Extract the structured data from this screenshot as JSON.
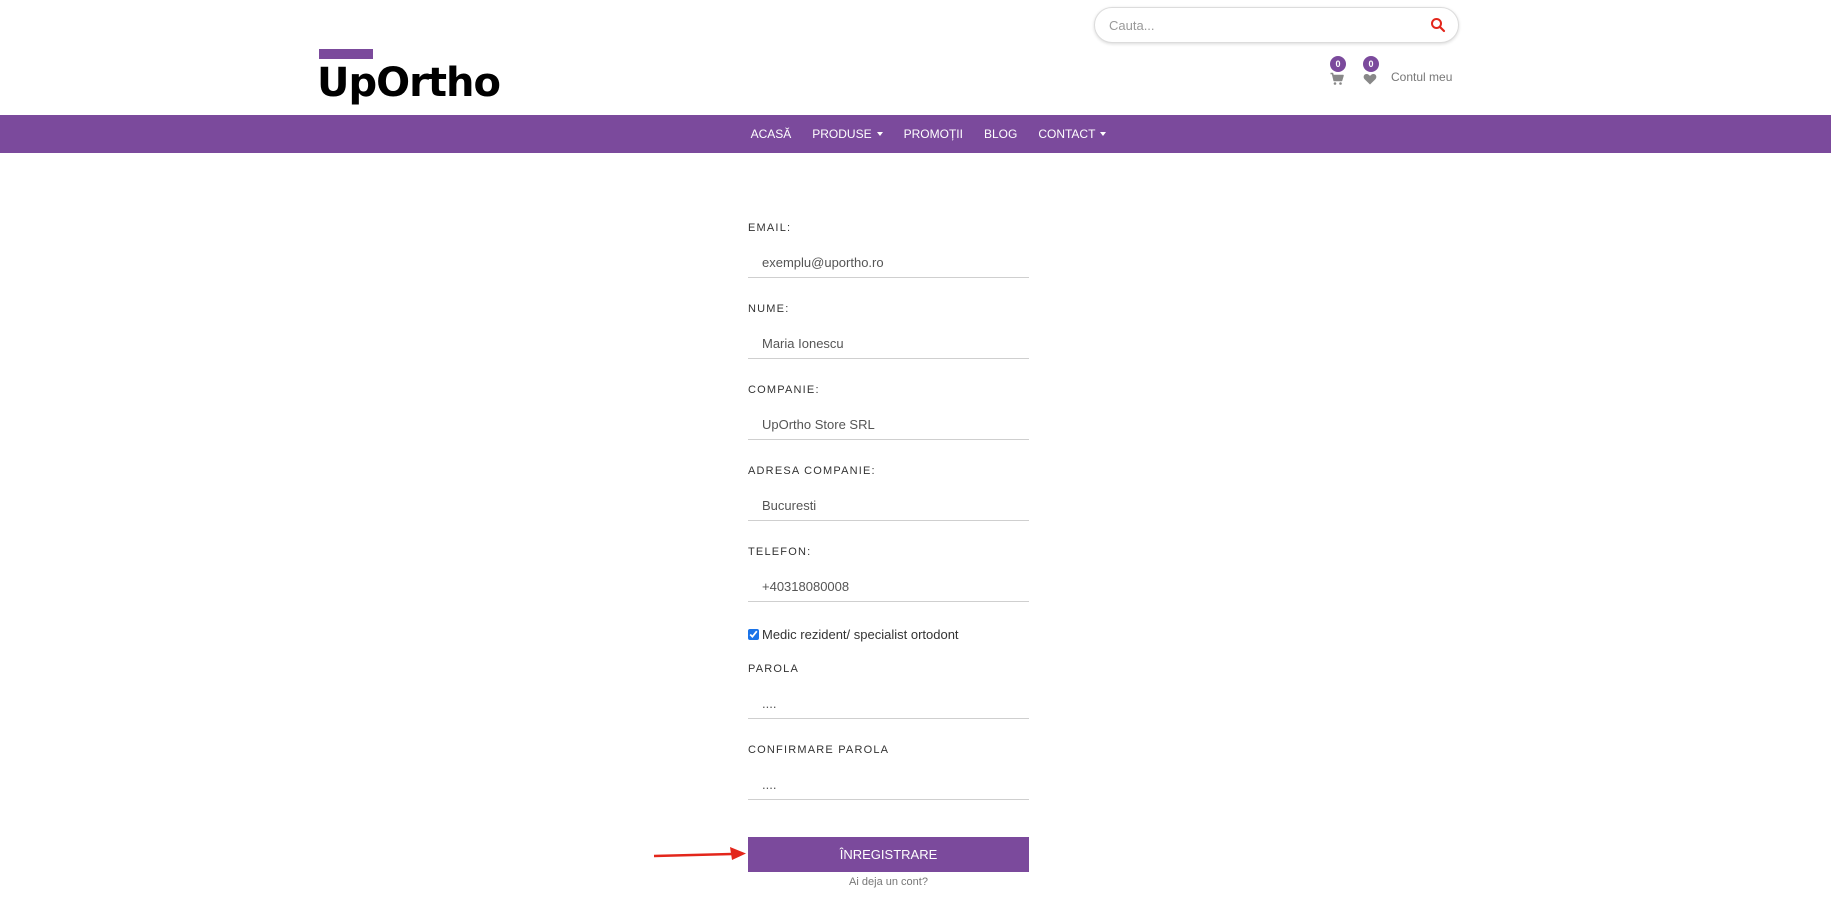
{
  "colors": {
    "brand": "#7b4a9c",
    "accent_red": "#e3261b",
    "icon_gray": "#888888"
  },
  "header": {
    "search": {
      "placeholder": "Cauta...",
      "icon": "search-icon"
    },
    "logo": {
      "text": "UpOrtho"
    },
    "cart": {
      "count": "0",
      "icon": "cart-icon"
    },
    "wishlist": {
      "count": "0",
      "icon": "heart-icon"
    },
    "account_label": "Contul meu"
  },
  "nav": {
    "items": [
      {
        "label": "ACASĂ",
        "dropdown": false
      },
      {
        "label": "PRODUSE",
        "dropdown": true
      },
      {
        "label": "PROMOȚII",
        "dropdown": false
      },
      {
        "label": "BLOG",
        "dropdown": false
      },
      {
        "label": "CONTACT",
        "dropdown": true
      }
    ]
  },
  "form": {
    "fields": [
      {
        "label": "EMAIL:",
        "value": "exemplu@uportho.ro"
      },
      {
        "label": "NUME:",
        "value": "Maria Ionescu"
      },
      {
        "label": "COMPANIE:",
        "value": "UpOrtho Store SRL"
      },
      {
        "label": "ADRESA COMPANIE:",
        "value": "Bucuresti"
      },
      {
        "label": "TELEFON:",
        "value": "+40318080008"
      }
    ],
    "checkbox": {
      "label": "Medic rezident/ specialist ortodont",
      "checked": true
    },
    "password": {
      "label": "PAROLA",
      "value": "...."
    },
    "confirm_password": {
      "label": "CONFIRMARE PAROLA",
      "value": "...."
    },
    "submit_label": "ÎNREGISTRARE",
    "login_link": "Ai deja un cont?"
  }
}
